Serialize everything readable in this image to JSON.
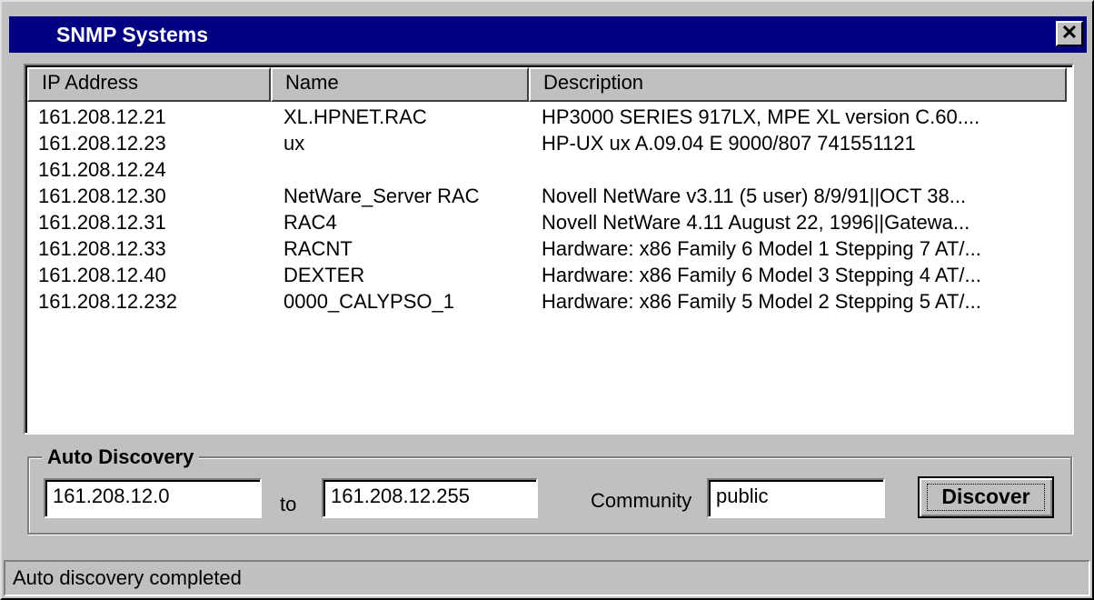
{
  "window": {
    "title": "SNMP Systems",
    "close_glyph": "✕",
    "close_icon": "close-icon"
  },
  "list": {
    "columns": [
      "IP Address",
      "Name",
      "Description"
    ],
    "rows": [
      {
        "ip": "161.208.12.21",
        "name": "XL.HPNET.RAC",
        "description": "HP3000 SERIES 917LX,  MPE XL version C.60...."
      },
      {
        "ip": "161.208.12.23",
        "name": "ux",
        "description": "HP-UX ux A.09.04 E 9000/807 741551121"
      },
      {
        "ip": "161.208.12.24",
        "name": "",
        "description": ""
      },
      {
        "ip": "161.208.12.30",
        "name": "NetWare_Server RAC",
        "description": "Novell NetWare v3.11 (5 user)  8/9/91||OCT 38..."
      },
      {
        "ip": "161.208.12.31",
        "name": "RAC4",
        "description": "Novell NetWare 4.11  August 22, 1996||Gatewa..."
      },
      {
        "ip": "161.208.12.33",
        "name": "RACNT",
        "description": "Hardware: x86 Family 6 Model 1 Stepping 7 AT/..."
      },
      {
        "ip": "161.208.12.40",
        "name": "DEXTER",
        "description": "Hardware: x86 Family 6 Model 3 Stepping 4 AT/..."
      },
      {
        "ip": "161.208.12.232",
        "name": "0000_CALYPSO_1",
        "description": "Hardware: x86 Family 5 Model 2 Stepping 5 AT/..."
      }
    ]
  },
  "auto_discovery": {
    "label": "Auto Discovery",
    "from_value": "161.208.12.0",
    "to_label": "to",
    "to_value": "161.208.12.255",
    "community_label": "Community",
    "community_value": "public",
    "discover_label": "Discover"
  },
  "status": {
    "text": "Auto discovery completed"
  }
}
